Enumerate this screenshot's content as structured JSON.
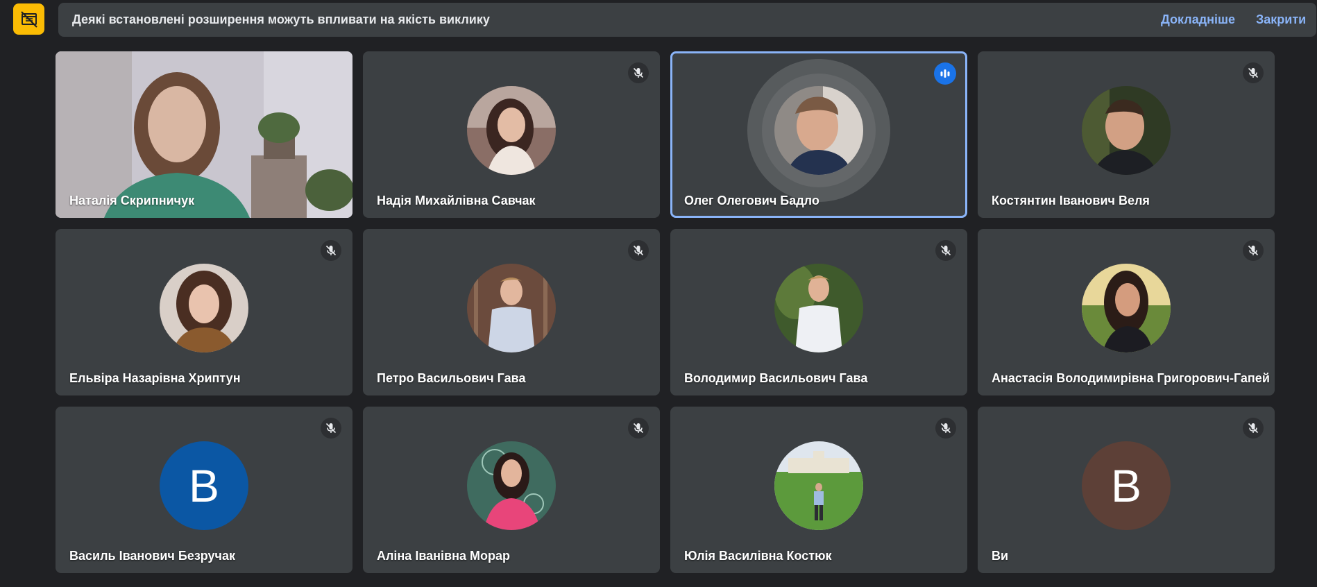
{
  "banner": {
    "message": "Деякі встановлені розширення можуть впливати на якість виклику",
    "learn_more": "Докладніше",
    "close": "Закрити"
  },
  "participants": [
    {
      "name": "Наталія Скрипничук",
      "mic": "on",
      "view": "video"
    },
    {
      "name": "Надія Михайлівна Савчак",
      "mic": "muted",
      "view": "photo"
    },
    {
      "name": "Олег Олегович Бадло",
      "mic": "speaking",
      "view": "photo"
    },
    {
      "name": "Костянтин Іванович Веля",
      "mic": "muted",
      "view": "photo"
    },
    {
      "name": "Ельвіра Назарівна Хриптун",
      "mic": "muted",
      "view": "photo"
    },
    {
      "name": "Петро Васильович Гава",
      "mic": "muted",
      "view": "photo"
    },
    {
      "name": "Володимир Васильович Гава",
      "mic": "muted",
      "view": "photo"
    },
    {
      "name": "Анастасія Володимирівна Григорович-Гапей",
      "mic": "muted",
      "view": "photo"
    },
    {
      "name": "Василь Іванович Безручак",
      "mic": "muted",
      "view": "initial",
      "initial": "В",
      "color": "#0b57a4"
    },
    {
      "name": "Аліна Іванівна Морар",
      "mic": "muted",
      "view": "photo"
    },
    {
      "name": "Юлія Василівна Костюк",
      "mic": "muted",
      "view": "photo"
    },
    {
      "name": "Ви",
      "mic": "muted",
      "view": "initial",
      "initial": "В",
      "color": "#5d4037"
    }
  ],
  "colors": {
    "background": "#202124",
    "tile": "#3c4043",
    "accent": "#8ab4f8",
    "warning": "#fbbc04"
  },
  "icons": {
    "warning": "extension-warning-icon",
    "muted": "mic-off-icon",
    "speaking": "audio-level-icon"
  }
}
